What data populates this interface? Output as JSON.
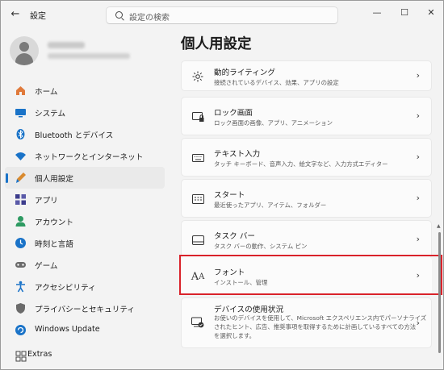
{
  "window": {
    "title": "設定",
    "back_glyph": "←",
    "controls": {
      "minimize": "—",
      "maximize": "☐",
      "close": "✕"
    }
  },
  "search": {
    "placeholder": "設定の検索"
  },
  "sidebar": {
    "items": [
      {
        "label": "ホーム",
        "icon": "home-icon",
        "color": "#e07a3b"
      },
      {
        "label": "システム",
        "icon": "system-icon",
        "color": "#1a73c8"
      },
      {
        "label": "Bluetooth とデバイス",
        "icon": "bluetooth-icon",
        "color": "#1a73c8"
      },
      {
        "label": "ネットワークとインターネット",
        "icon": "network-icon",
        "color": "#1a73c8"
      },
      {
        "label": "個人用設定",
        "icon": "personalization-icon",
        "color": "#d98a2e",
        "selected": true
      },
      {
        "label": "アプリ",
        "icon": "apps-icon",
        "color": "#3c3c8c"
      },
      {
        "label": "アカウント",
        "icon": "account-icon",
        "color": "#2e9a62"
      },
      {
        "label": "時刻と言語",
        "icon": "time-language-icon",
        "color": "#1a73c8"
      },
      {
        "label": "ゲーム",
        "icon": "gaming-icon",
        "color": "#6b6b6b"
      },
      {
        "label": "アクセシビリティ",
        "icon": "accessibility-icon",
        "color": "#1a73c8"
      },
      {
        "label": "プライバシーとセキュリティ",
        "icon": "privacy-icon",
        "color": "#6b6b6b"
      },
      {
        "label": "Windows Update",
        "icon": "windows-update-icon",
        "color": "#1a73c8"
      }
    ],
    "extras": {
      "label": "Extras",
      "icon": "extras-icon"
    }
  },
  "main": {
    "title": "個人用設定",
    "cards": [
      {
        "title": "動的ライティング",
        "sub": [
          "接続されているデバイス、効果、アプリの設定"
        ],
        "icon": "dynamic-lighting-icon"
      },
      {
        "title": "ロック画面",
        "sub": [
          "ロック画面の画像、アプリ、アニメーション"
        ],
        "icon": "lock-screen-icon"
      },
      {
        "title": "テキスト入力",
        "sub": [
          "タッチ キーボード、音声入力、絵文字など、入力方式エディター"
        ],
        "icon": "keyboard-icon"
      },
      {
        "title": "スタート",
        "sub": [
          "最近使ったアプリ、アイテム、フォルダー"
        ],
        "icon": "start-icon"
      },
      {
        "title": "タスク バー",
        "sub": [
          "タスク バーの動作、システム ピン"
        ],
        "icon": "taskbar-icon"
      },
      {
        "title": "フォント",
        "sub": [
          "インストール、管理"
        ],
        "icon": "fonts-icon",
        "highlighted": true
      },
      {
        "title": "デバイスの使用状況",
        "sub": [
          "お使いのデバイスを使用して、Microsoft エクスペリエンス内でパーソナライズ",
          "されたヒント、広告、推奨事項を取得するために計画しているすべての方法",
          "を選択します。"
        ],
        "icon": "device-usage-icon"
      }
    ],
    "chevron": "›",
    "highlight_color": "#d9222a"
  }
}
